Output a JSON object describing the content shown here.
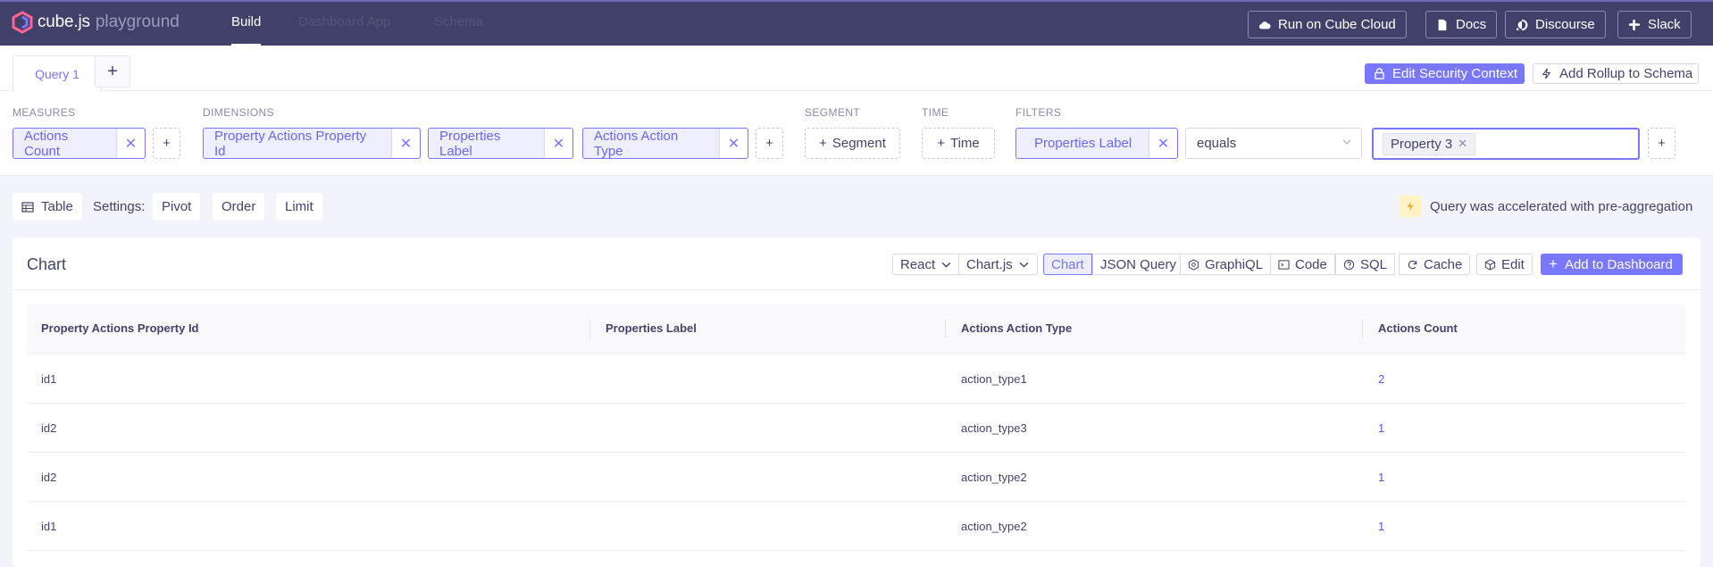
{
  "app": {
    "logo_text": "cube.js",
    "logo_sub": "playground"
  },
  "nav": {
    "tabs": [
      {
        "label": "Build",
        "active": true
      },
      {
        "label": "Dashboard App",
        "active": false
      },
      {
        "label": "Schema",
        "active": false
      }
    ],
    "buttons": [
      {
        "label": "Run on Cube Cloud",
        "icon": "cloud-icon"
      },
      {
        "label": "Docs",
        "icon": "file-icon"
      },
      {
        "label": "Discourse",
        "icon": "chat-icon"
      },
      {
        "label": "Slack",
        "icon": "slack-icon"
      }
    ]
  },
  "query_tabs": {
    "active": "Query 1",
    "add": "+"
  },
  "query_actions": {
    "security": "Edit Security Context",
    "rollup": "Add Rollup to Schema"
  },
  "sections": {
    "measures": "MEASURES",
    "dimensions": "DIMENSIONS",
    "segment": "SEGMENT",
    "time": "TIME",
    "filters": "FILTERS"
  },
  "measures": [
    "Actions Count"
  ],
  "dimensions": [
    "Property Actions Property Id",
    "Properties Label",
    "Actions Action Type"
  ],
  "segment_button": "Segment",
  "time_button": "Time",
  "filter": {
    "member": "Properties Label",
    "operator": "equals",
    "values": [
      "Property 3"
    ]
  },
  "settings": {
    "view": "Table",
    "label": "Settings:",
    "pivot": "Pivot",
    "order": "Order",
    "limit": "Limit"
  },
  "accel_message": "Query was accelerated with pre-aggregation",
  "card": {
    "title": "Chart",
    "framework": "React",
    "library": "Chart.js",
    "tabs": [
      "Chart",
      "JSON Query",
      "GraphiQL",
      "Code",
      "SQL",
      "Cache"
    ],
    "edit": "Edit",
    "add_to_dashboard": "Add to Dashboard"
  },
  "table": {
    "columns": [
      "Property Actions Property Id",
      "Properties Label",
      "Actions Action Type",
      "Actions Count"
    ],
    "rows": [
      [
        "id1",
        "",
        "action_type1",
        "2"
      ],
      [
        "id2",
        "",
        "action_type3",
        "1"
      ],
      [
        "id2",
        "",
        "action_type2",
        "1"
      ],
      [
        "id1",
        "",
        "action_type2",
        "1"
      ]
    ]
  },
  "colors": {
    "nav_bg": "#41406b",
    "accent": "#7a77ff"
  }
}
